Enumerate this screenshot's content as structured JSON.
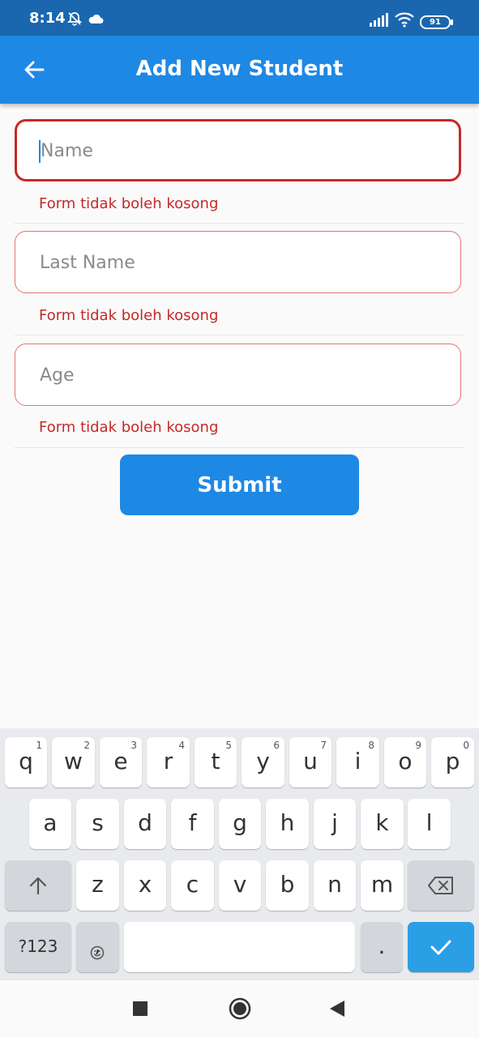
{
  "status_bar": {
    "time": "8:14",
    "battery": "91",
    "icons": [
      "bell-off-icon",
      "cloud-icon",
      "signal-icon",
      "wifi-icon",
      "battery-icon"
    ]
  },
  "app_bar": {
    "title": "Add New Student",
    "back_icon": "arrow-left-icon"
  },
  "form": {
    "fields": [
      {
        "placeholder": "Name",
        "value": "",
        "error": "Form tidak boleh kosong",
        "focused": true
      },
      {
        "placeholder": "Last Name",
        "value": "",
        "error": "Form tidak boleh kosong",
        "focused": false
      },
      {
        "placeholder": "Age",
        "value": "",
        "error": "Form tidak boleh kosong",
        "focused": false
      }
    ],
    "submit_label": "Submit"
  },
  "keyboard": {
    "row1": [
      "q",
      "w",
      "e",
      "r",
      "t",
      "y",
      "u",
      "i",
      "o",
      "p"
    ],
    "row1_hints": [
      "1",
      "2",
      "3",
      "4",
      "5",
      "6",
      "7",
      "8",
      "9",
      "0"
    ],
    "row2": [
      "a",
      "s",
      "d",
      "f",
      "g",
      "h",
      "j",
      "k",
      "l"
    ],
    "row3": [
      "z",
      "x",
      "c",
      "v",
      "b",
      "n",
      "m"
    ],
    "symbols_label": "?123",
    "emoji_icon": "emoji-icon",
    "comma": ",",
    "period": ".",
    "shift_icon": "shift-arrow-icon",
    "backspace_icon": "backspace-icon",
    "enter_icon": "check-icon"
  },
  "nav_bar": {
    "icons": [
      "recents-square-icon",
      "home-circle-icon",
      "back-triangle-icon"
    ]
  },
  "colors": {
    "status_bar": "#1a67b0",
    "app_bar": "#1e88e5",
    "error": "#c62828",
    "error_border": "#e57373"
  }
}
